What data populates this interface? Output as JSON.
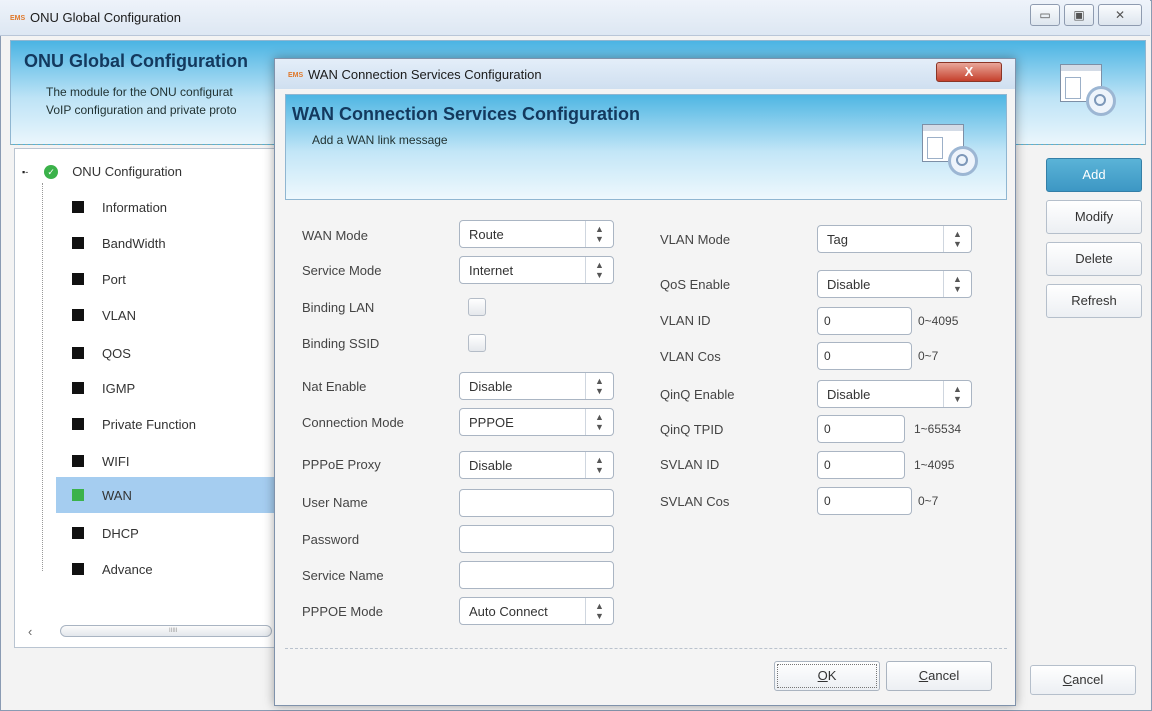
{
  "window": {
    "brand": "EMS",
    "title": "ONU Global Configuration",
    "header_title": "ONU Global Configuration",
    "header_desc_1": "The module for the ONU configurat",
    "header_desc_2": "VoIP configuration and private proto"
  },
  "tree": {
    "root_label": "ONU Configuration",
    "items": [
      {
        "label": "Information"
      },
      {
        "label": "BandWidth"
      },
      {
        "label": "Port"
      },
      {
        "label": "VLAN"
      },
      {
        "label": "QOS"
      },
      {
        "label": "IGMP"
      },
      {
        "label": "Private Function"
      },
      {
        "label": "WIFI"
      },
      {
        "label": "WAN"
      },
      {
        "label": "DHCP"
      },
      {
        "label": "Advance"
      }
    ],
    "selected": "WAN",
    "scroll_grip": "IIIII"
  },
  "side_buttons": {
    "add": "Add",
    "modify": "Modify",
    "delete": "Delete",
    "refresh": "Refresh",
    "cancel_pre": "C",
    "cancel_rest": "ancel"
  },
  "dialog": {
    "brand": "EMS",
    "title": "WAN Connection Services Configuration",
    "close": "X",
    "header_title": "WAN Connection Services Configuration",
    "header_desc": "Add a WAN link message",
    "left": {
      "wan_mode_label": "WAN Mode",
      "wan_mode_value": "Route",
      "service_mode_label": "Service Mode",
      "service_mode_value": "Internet",
      "binding_lan_label": "Binding LAN",
      "binding_ssid_label": "Binding SSID",
      "nat_label": "Nat Enable",
      "nat_value": "Disable",
      "conn_mode_label": "Connection Mode",
      "conn_mode_value": "PPPOE",
      "pppoe_proxy_label": "PPPoE Proxy",
      "pppoe_proxy_value": "Disable",
      "username_label": "User Name",
      "username_value": "",
      "password_label": "Password",
      "password_value": "",
      "service_name_label": "Service Name",
      "service_name_value": "",
      "pppoe_mode_label": "PPPOE Mode",
      "pppoe_mode_value": "Auto Connect"
    },
    "right": {
      "vlan_mode_label": "VLAN Mode",
      "vlan_mode_value": "Tag",
      "qos_label": "QoS Enable",
      "qos_value": "Disable",
      "vlan_id_label": "VLAN ID",
      "vlan_id_value": "0",
      "vlan_id_range": "0~4095",
      "vlan_cos_label": "VLAN Cos",
      "vlan_cos_value": "0",
      "vlan_cos_range": "0~7",
      "qinq_label": "QinQ Enable",
      "qinq_value": "Disable",
      "qinq_tpid_label": "QinQ TPID",
      "qinq_tpid_value": "0",
      "qinq_tpid_range": "1~65534",
      "svlan_id_label": "SVLAN ID",
      "svlan_id_value": "0",
      "svlan_id_range": "1~4095",
      "svlan_cos_label": "SVLAN Cos",
      "svlan_cos_value": "0",
      "svlan_cos_range": "0~7"
    },
    "ok_pre": "O",
    "ok_rest": "K",
    "cancel_pre": "C",
    "cancel_rest": "ancel"
  }
}
